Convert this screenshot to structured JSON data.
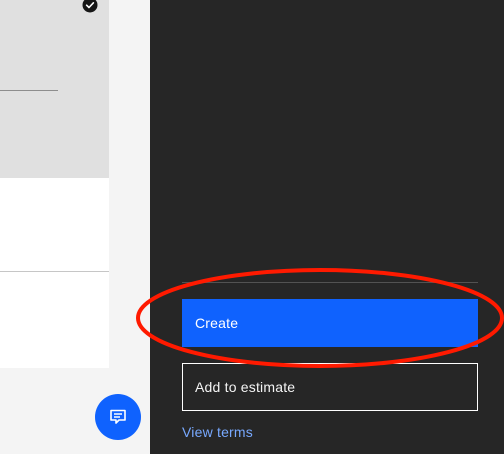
{
  "panel": {
    "primary_label": "Create",
    "secondary_label": "Add to estimate",
    "terms_label": "View terms"
  },
  "icons": {
    "selected": "checkmark-filled-icon",
    "chat": "chat-icon"
  },
  "colors": {
    "accent": "#0f62fe",
    "panel_bg": "#262626",
    "link": "#78a9ff",
    "annotation": "#ff1a00"
  }
}
